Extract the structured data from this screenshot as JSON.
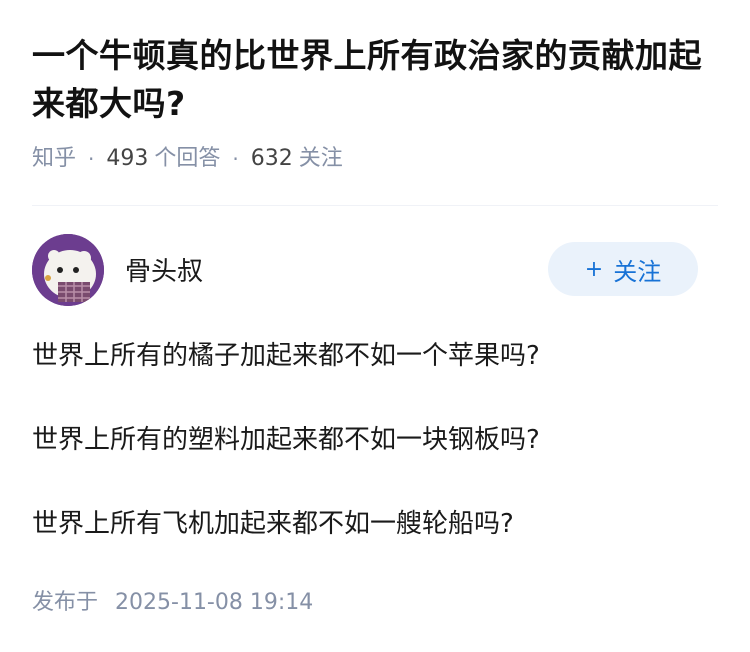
{
  "question": {
    "title": "一个牛顿真的比世界上所有政治家的贡献加起来都大吗?",
    "source": "知乎",
    "answer_count": "493",
    "answer_label": "个回答",
    "follower_count": "632",
    "follower_label": "关注"
  },
  "answer": {
    "author_name": "骨头叔",
    "follow_button": {
      "icon": "+",
      "label": "关注"
    },
    "paragraphs": [
      "世界上所有的橘子加起来都不如一个苹果吗?",
      "世界上所有的塑料加起来都不如一块钢板吗?",
      "世界上所有飞机加起来都不如一艘轮船吗?"
    ],
    "publish_label": "发布于",
    "publish_time": "2025-11-08 19:14"
  },
  "colors": {
    "meta_gray": "#8590a6",
    "accent_blue": "#1772d6",
    "button_bg": "#eaf2fb",
    "avatar_bg": "#6c3d8f"
  }
}
